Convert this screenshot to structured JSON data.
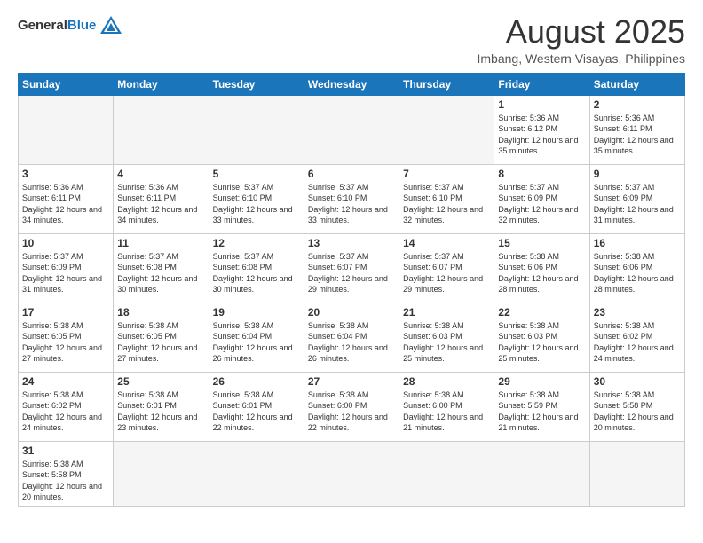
{
  "header": {
    "logo_general": "General",
    "logo_blue": "Blue",
    "month_title": "August 2025",
    "location": "Imbang, Western Visayas, Philippines"
  },
  "weekdays": [
    "Sunday",
    "Monday",
    "Tuesday",
    "Wednesday",
    "Thursday",
    "Friday",
    "Saturday"
  ],
  "weeks": [
    [
      {
        "day": "",
        "info": ""
      },
      {
        "day": "",
        "info": ""
      },
      {
        "day": "",
        "info": ""
      },
      {
        "day": "",
        "info": ""
      },
      {
        "day": "",
        "info": ""
      },
      {
        "day": "1",
        "info": "Sunrise: 5:36 AM\nSunset: 6:12 PM\nDaylight: 12 hours and 35 minutes."
      },
      {
        "day": "2",
        "info": "Sunrise: 5:36 AM\nSunset: 6:11 PM\nDaylight: 12 hours and 35 minutes."
      }
    ],
    [
      {
        "day": "3",
        "info": "Sunrise: 5:36 AM\nSunset: 6:11 PM\nDaylight: 12 hours and 34 minutes."
      },
      {
        "day": "4",
        "info": "Sunrise: 5:36 AM\nSunset: 6:11 PM\nDaylight: 12 hours and 34 minutes."
      },
      {
        "day": "5",
        "info": "Sunrise: 5:37 AM\nSunset: 6:10 PM\nDaylight: 12 hours and 33 minutes."
      },
      {
        "day": "6",
        "info": "Sunrise: 5:37 AM\nSunset: 6:10 PM\nDaylight: 12 hours and 33 minutes."
      },
      {
        "day": "7",
        "info": "Sunrise: 5:37 AM\nSunset: 6:10 PM\nDaylight: 12 hours and 32 minutes."
      },
      {
        "day": "8",
        "info": "Sunrise: 5:37 AM\nSunset: 6:09 PM\nDaylight: 12 hours and 32 minutes."
      },
      {
        "day": "9",
        "info": "Sunrise: 5:37 AM\nSunset: 6:09 PM\nDaylight: 12 hours and 31 minutes."
      }
    ],
    [
      {
        "day": "10",
        "info": "Sunrise: 5:37 AM\nSunset: 6:09 PM\nDaylight: 12 hours and 31 minutes."
      },
      {
        "day": "11",
        "info": "Sunrise: 5:37 AM\nSunset: 6:08 PM\nDaylight: 12 hours and 30 minutes."
      },
      {
        "day": "12",
        "info": "Sunrise: 5:37 AM\nSunset: 6:08 PM\nDaylight: 12 hours and 30 minutes."
      },
      {
        "day": "13",
        "info": "Sunrise: 5:37 AM\nSunset: 6:07 PM\nDaylight: 12 hours and 29 minutes."
      },
      {
        "day": "14",
        "info": "Sunrise: 5:37 AM\nSunset: 6:07 PM\nDaylight: 12 hours and 29 minutes."
      },
      {
        "day": "15",
        "info": "Sunrise: 5:38 AM\nSunset: 6:06 PM\nDaylight: 12 hours and 28 minutes."
      },
      {
        "day": "16",
        "info": "Sunrise: 5:38 AM\nSunset: 6:06 PM\nDaylight: 12 hours and 28 minutes."
      }
    ],
    [
      {
        "day": "17",
        "info": "Sunrise: 5:38 AM\nSunset: 6:05 PM\nDaylight: 12 hours and 27 minutes."
      },
      {
        "day": "18",
        "info": "Sunrise: 5:38 AM\nSunset: 6:05 PM\nDaylight: 12 hours and 27 minutes."
      },
      {
        "day": "19",
        "info": "Sunrise: 5:38 AM\nSunset: 6:04 PM\nDaylight: 12 hours and 26 minutes."
      },
      {
        "day": "20",
        "info": "Sunrise: 5:38 AM\nSunset: 6:04 PM\nDaylight: 12 hours and 26 minutes."
      },
      {
        "day": "21",
        "info": "Sunrise: 5:38 AM\nSunset: 6:03 PM\nDaylight: 12 hours and 25 minutes."
      },
      {
        "day": "22",
        "info": "Sunrise: 5:38 AM\nSunset: 6:03 PM\nDaylight: 12 hours and 25 minutes."
      },
      {
        "day": "23",
        "info": "Sunrise: 5:38 AM\nSunset: 6:02 PM\nDaylight: 12 hours and 24 minutes."
      }
    ],
    [
      {
        "day": "24",
        "info": "Sunrise: 5:38 AM\nSunset: 6:02 PM\nDaylight: 12 hours and 24 minutes."
      },
      {
        "day": "25",
        "info": "Sunrise: 5:38 AM\nSunset: 6:01 PM\nDaylight: 12 hours and 23 minutes."
      },
      {
        "day": "26",
        "info": "Sunrise: 5:38 AM\nSunset: 6:01 PM\nDaylight: 12 hours and 22 minutes."
      },
      {
        "day": "27",
        "info": "Sunrise: 5:38 AM\nSunset: 6:00 PM\nDaylight: 12 hours and 22 minutes."
      },
      {
        "day": "28",
        "info": "Sunrise: 5:38 AM\nSunset: 6:00 PM\nDaylight: 12 hours and 21 minutes."
      },
      {
        "day": "29",
        "info": "Sunrise: 5:38 AM\nSunset: 5:59 PM\nDaylight: 12 hours and 21 minutes."
      },
      {
        "day": "30",
        "info": "Sunrise: 5:38 AM\nSunset: 5:58 PM\nDaylight: 12 hours and 20 minutes."
      }
    ],
    [
      {
        "day": "31",
        "info": "Sunrise: 5:38 AM\nSunset: 5:58 PM\nDaylight: 12 hours and 20 minutes."
      },
      {
        "day": "",
        "info": ""
      },
      {
        "day": "",
        "info": ""
      },
      {
        "day": "",
        "info": ""
      },
      {
        "day": "",
        "info": ""
      },
      {
        "day": "",
        "info": ""
      },
      {
        "day": "",
        "info": ""
      }
    ]
  ]
}
